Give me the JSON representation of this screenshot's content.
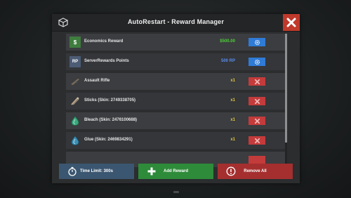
{
  "header": {
    "title": "AutoRestart - Reward Manager"
  },
  "rewards": [
    {
      "label": "Economics Reward",
      "amount": "$500.00",
      "amount_color": "#4cd137",
      "icon": "dollar-icon",
      "icon_text": "$",
      "action": "edit"
    },
    {
      "label": "ServerRewards Points",
      "amount": "500 RP",
      "amount_color": "#5a8dee",
      "icon": "rp-icon",
      "icon_text": "RP",
      "action": "edit"
    },
    {
      "label": "Assault Rifle",
      "amount": "x1",
      "amount_color": "#e1c542",
      "icon": "rifle-icon",
      "icon_text": "",
      "action": "delete"
    },
    {
      "label": "Sticks (Skin: 2749338705)",
      "amount": "x1",
      "amount_color": "#e1c542",
      "icon": "sticks-icon",
      "icon_text": "",
      "action": "delete"
    },
    {
      "label": "Bleach (Skin: 2476100688)",
      "amount": "x1",
      "amount_color": "#e1c542",
      "icon": "bleach-icon",
      "icon_text": "",
      "action": "delete"
    },
    {
      "label": "Glue (Skin: 2469834291)",
      "amount": "x1",
      "amount_color": "#e1c542",
      "icon": "glue-icon",
      "icon_text": "",
      "action": "delete"
    }
  ],
  "footer": {
    "time_limit": "Time Limit: 300s",
    "add_reward": "Add Reward",
    "remove_all": "Remove All"
  },
  "colors": {
    "edit": "#2f7bd6",
    "delete": "#c43b3b",
    "close": "#c0392b",
    "add": "#2e8b3a"
  }
}
